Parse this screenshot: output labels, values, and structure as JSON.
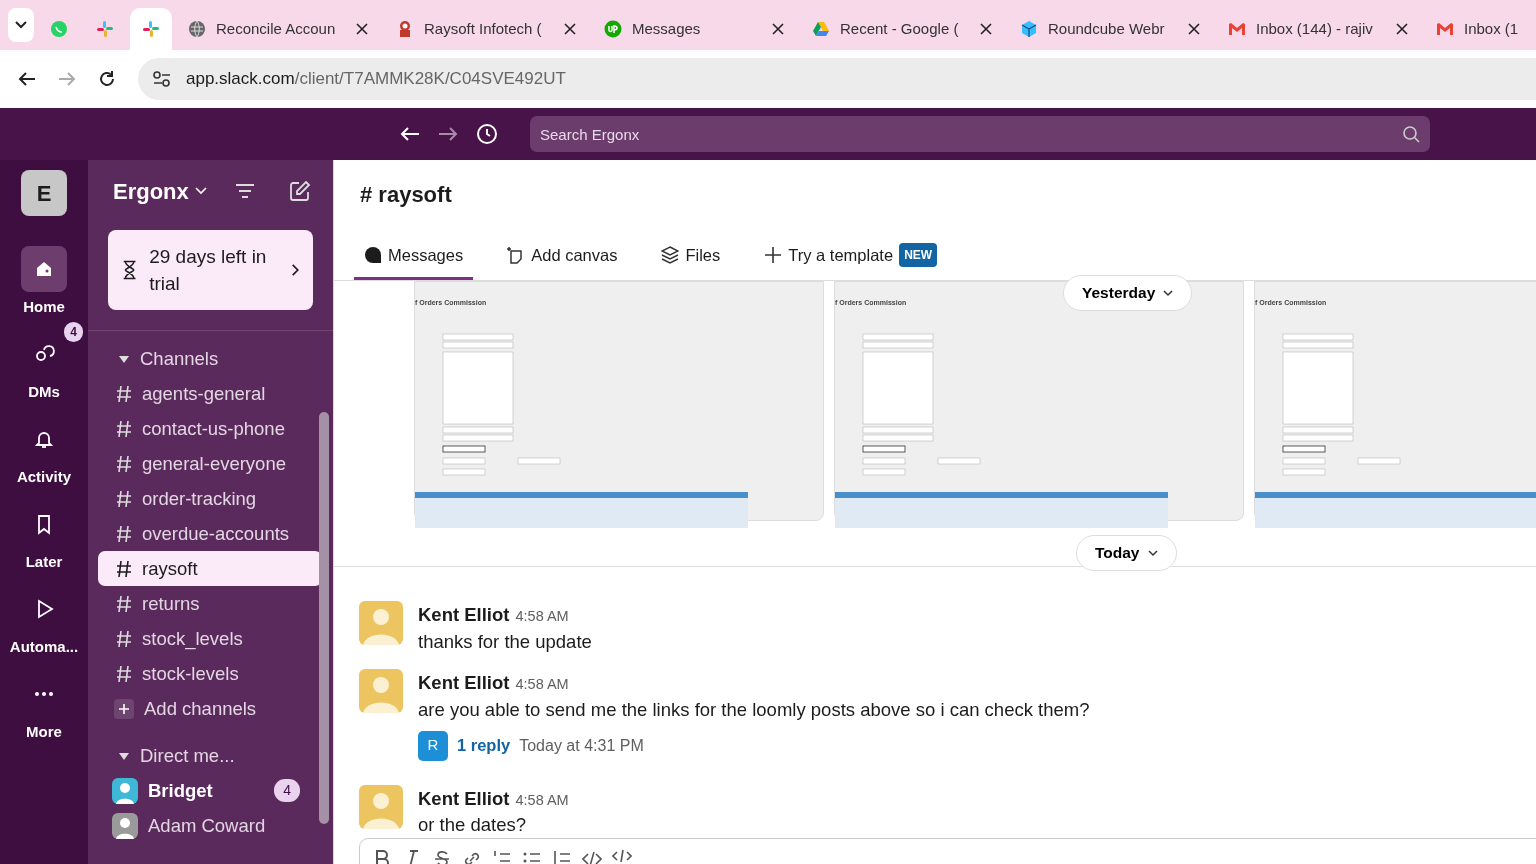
{
  "browser": {
    "tabs": [
      {
        "kind": "whatsapp",
        "selected": false
      },
      {
        "kind": "slack",
        "selected": false
      },
      {
        "kind": "slack",
        "selected": true
      },
      {
        "kind": "globe",
        "title": "Reconcile Accoun",
        "selected": false
      },
      {
        "kind": "raysoft",
        "title": "Raysoft Infotech (",
        "selected": false
      },
      {
        "kind": "upwork",
        "title": "Messages",
        "selected": false
      },
      {
        "kind": "drive",
        "title": "Recent - Google (",
        "selected": false
      },
      {
        "kind": "roundcube",
        "title": "Roundcube Webr",
        "selected": false
      },
      {
        "kind": "gmail",
        "title": "Inbox (144) - rajiv",
        "selected": false
      },
      {
        "kind": "gmail",
        "title": "Inbox (1",
        "selected": false
      }
    ],
    "url_host": "app.slack.com",
    "url_path": "/client/T7AMMK28K/C04SVE492UT"
  },
  "topbar": {
    "search_placeholder": "Search Ergonx"
  },
  "rail": {
    "workspace_initial": "E",
    "items": [
      {
        "kind": "home",
        "label": "Home",
        "selected": true
      },
      {
        "kind": "dms",
        "label": "DMs",
        "selected": false,
        "badge": "4"
      },
      {
        "kind": "activity",
        "label": "Activity",
        "selected": false
      },
      {
        "kind": "later",
        "label": "Later",
        "selected": false
      },
      {
        "kind": "automations",
        "label": "Automa...",
        "selected": false
      },
      {
        "kind": "more",
        "label": "More",
        "selected": false
      }
    ]
  },
  "sidebar": {
    "workspace": "Ergonx",
    "trial": "29 days left in trial",
    "channels_header": {
      "label": "Channels",
      "expanded": true
    },
    "channels": [
      {
        "name": "agents-general",
        "selected": false
      },
      {
        "name": "contact-us-phone",
        "selected": false
      },
      {
        "name": "general-everyone",
        "selected": false
      },
      {
        "name": "order-tracking",
        "selected": false
      },
      {
        "name": "overdue-accounts",
        "selected": false
      },
      {
        "name": "raysoft",
        "selected": true
      },
      {
        "name": "returns",
        "selected": false
      },
      {
        "name": "stock_levels",
        "selected": false
      },
      {
        "name": "stock-levels",
        "selected": false
      }
    ],
    "add_channels": "Add channels",
    "dms_header": {
      "label": "Direct me...",
      "expanded": true
    },
    "dms": [
      {
        "name": "Bridget",
        "unread": true,
        "badge": "4",
        "color": "#3fb8d8"
      },
      {
        "name": "Adam Coward",
        "unread": false,
        "color": "#9a9a9a"
      }
    ]
  },
  "channel": {
    "title": "# raysoft",
    "tabs": [
      {
        "kind": "messages",
        "label": "Messages",
        "selected": true
      },
      {
        "kind": "canvas",
        "label": "Add canvas",
        "selected": false
      },
      {
        "kind": "files",
        "label": "Files",
        "selected": false
      },
      {
        "kind": "template",
        "label": "Try a template",
        "selected": false,
        "badge": "NEW"
      }
    ]
  },
  "attachments": [
    {
      "title": "f Orders Commission"
    },
    {
      "title": "f Orders Commission"
    },
    {
      "title": "f Orders Commission"
    }
  ],
  "date_pills": [
    "Yesterday",
    "Today"
  ],
  "messages": [
    {
      "author": "Kent Elliot",
      "time": "4:58 AM",
      "text": "thanks for the update"
    },
    {
      "author": "Kent Elliot",
      "time": "4:58 AM",
      "text": "are you able to send me the links for the loomly posts above so i can check them?",
      "thread": {
        "avatar": "R",
        "replies": "1 reply",
        "last": "Today at 4:31 PM"
      }
    },
    {
      "author": "Kent Elliot",
      "time": "4:58 AM",
      "text": "or the dates?"
    }
  ]
}
